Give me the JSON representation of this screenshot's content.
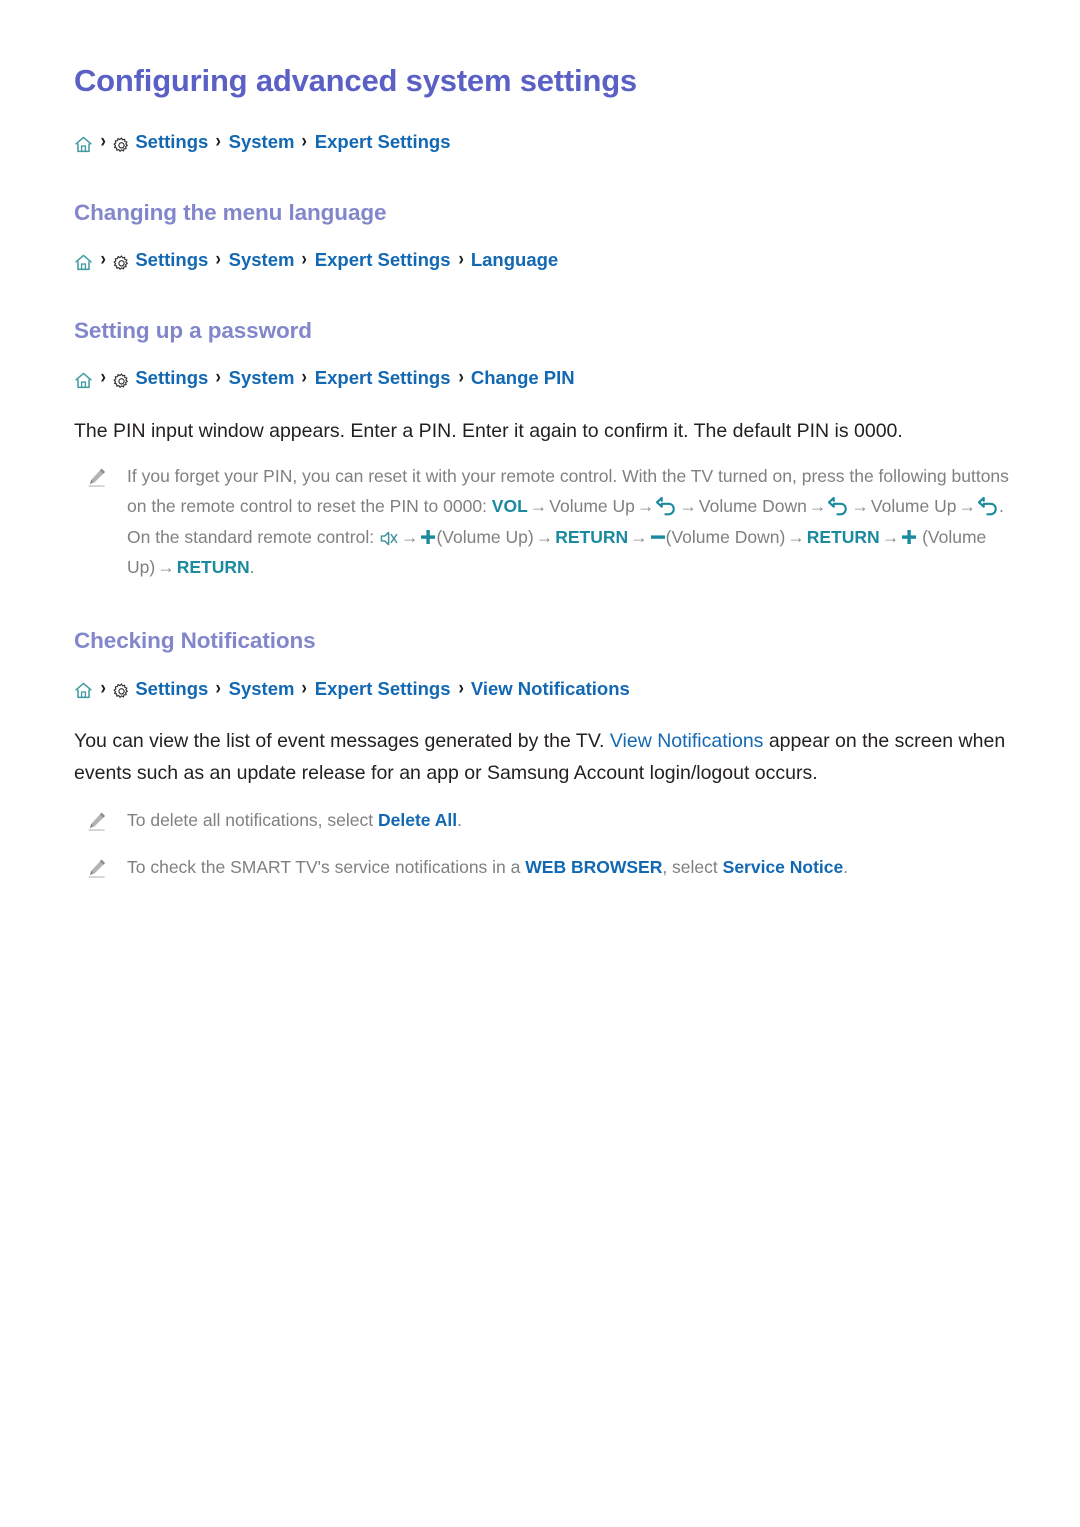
{
  "document": {
    "title": "Configuring advanced system settings"
  },
  "breadcrumbs": {
    "main": {
      "home_icon": "home-icon",
      "gear_icon": "gear-icon",
      "separator": "›",
      "items": [
        "Settings",
        "System",
        "Expert Settings"
      ]
    },
    "language": {
      "items": [
        "Settings",
        "System",
        "Expert Settings",
        "Language"
      ]
    },
    "change_pin": {
      "items": [
        "Settings",
        "System",
        "Expert Settings",
        "Change PIN"
      ]
    },
    "view_notifications": {
      "items": [
        "Settings",
        "System",
        "Expert Settings",
        "View Notifications"
      ]
    }
  },
  "sections": {
    "language": {
      "heading": "Changing the menu language"
    },
    "password": {
      "heading": "Setting up a password",
      "paragraph": "The PIN input window appears. Enter a PIN. Enter it again to confirm it. The default PIN is 0000.",
      "note": {
        "icon": "pencil-icon",
        "part1": "If you forget your PIN, you can reset it with your remote control. With the TV turned on, press the following buttons on the remote control to reset the PIN to 0000: ",
        "key_vol": "VOL",
        "arrow": "→",
        "volume_up": "Volume Up",
        "volume_down": "Volume Down",
        "return_glyph": "return-arrow-icon",
        "part2": ". On the standard remote control: ",
        "mute_glyph": "mute-icon",
        "plus_glyph": "plus-icon",
        "minus_glyph": "minus-icon",
        "volume_up_paren": "(Volume Up)",
        "volume_down_paren": "(Volume Down)",
        "key_return": "RETURN",
        "period": "."
      }
    },
    "notifications": {
      "heading": "Checking Notifications",
      "paragraph_pre": "You can view the list of event messages generated by the TV. ",
      "paragraph_link": "View Notifications",
      "paragraph_post": " appear on the screen when events such as an update release for an app or Samsung Account login/logout occurs.",
      "note1": {
        "icon": "pencil-icon",
        "pre": "To delete all notifications, select ",
        "link": "Delete All",
        "post": "."
      },
      "note2": {
        "icon": "pencil-icon",
        "pre": "To check the SMART TV's service notifications in a ",
        "link1": "WEB BROWSER",
        "mid": ", select ",
        "link2": "Service Notice",
        "post": "."
      }
    }
  },
  "colors": {
    "title": "#5b60c4",
    "section_heading": "#8287cb",
    "link_blue": "#1268b3",
    "key_teal": "#1b8a9e",
    "body": "#231f20",
    "note_gray": "#808080",
    "home_icon": "#3f9ba0"
  }
}
